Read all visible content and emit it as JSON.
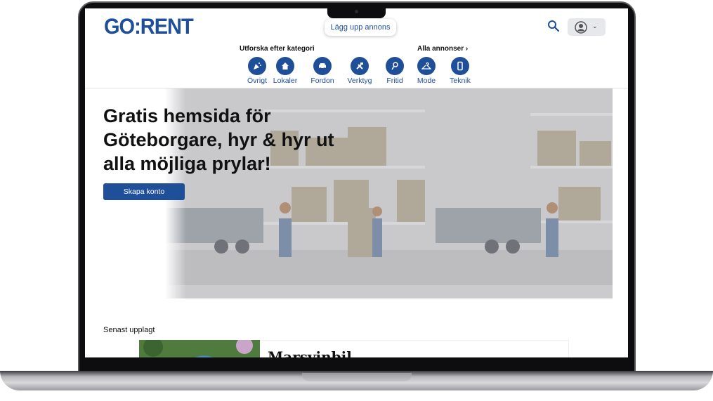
{
  "header": {
    "logo": "GO:RENT",
    "post_button": "Lägg upp annons",
    "search_icon": "search-icon",
    "profile_icon": "user-circle-icon",
    "chevron": "⌄"
  },
  "categories": {
    "heading": "Utforska efter kategori",
    "all_ads": "Alla annonser",
    "items": [
      {
        "label": "Övrigt",
        "icon": "party-popper-icon"
      },
      {
        "label": "Lokaler",
        "icon": "house-icon"
      },
      {
        "label": "Fordon",
        "icon": "car-icon"
      },
      {
        "label": "Verktyg",
        "icon": "tools-icon"
      },
      {
        "label": "Fritid",
        "icon": "fritid-icon"
      },
      {
        "label": "Mode",
        "icon": "hanger-icon"
      },
      {
        "label": "Teknik",
        "icon": "phone-icon"
      }
    ]
  },
  "hero": {
    "headline": "Gratis hemsida för Göteborgare, hyr & hyr ut alla möjliga prylar!",
    "cta": "Skapa konto"
  },
  "latest": {
    "heading": "Senast upplagt",
    "first_title": "Marsvinbil"
  },
  "colors": {
    "brand": "#1f4f99",
    "hero_tint": "#cfcfd2"
  }
}
